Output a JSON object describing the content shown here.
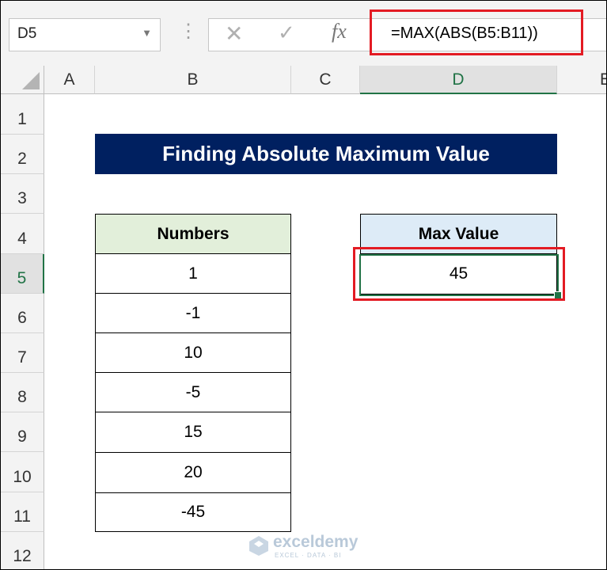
{
  "formula_bar": {
    "name_box": "D5",
    "formula": "=MAX(ABS(B5:B11))",
    "cancel_icon": "close-icon",
    "enter_icon": "check-icon",
    "function_icon": "fx-icon"
  },
  "columns": [
    "A",
    "B",
    "C",
    "D",
    "E"
  ],
  "selected_column": "D",
  "rows": [
    "1",
    "2",
    "3",
    "4",
    "5",
    "6",
    "7",
    "8",
    "9",
    "10",
    "11",
    "12"
  ],
  "selected_row": "5",
  "sheet": {
    "title": "Finding Absolute Maximum Value",
    "numbers_header": "Numbers",
    "numbers": [
      "1",
      "-1",
      "10",
      "-5",
      "15",
      "20",
      "-45"
    ],
    "max_header": "Max Value",
    "max_value": "45"
  },
  "watermark": {
    "name": "exceldemy",
    "tagline": "EXCEL · DATA · BI"
  },
  "colors": {
    "title_bg": "#002060",
    "numbers_header_bg": "#e2efda",
    "max_header_bg": "#ddebf7",
    "highlight": "#e31b23",
    "selection": "#217346"
  }
}
